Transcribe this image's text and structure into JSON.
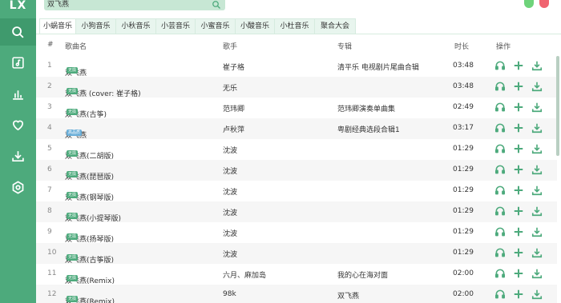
{
  "app": {
    "logo": "LX"
  },
  "search": {
    "value": "双飞燕"
  },
  "tabs": [
    {
      "label": "小蜗音乐",
      "active": true
    },
    {
      "label": "小狗音乐"
    },
    {
      "label": "小秋音乐"
    },
    {
      "label": "小芸音乐"
    },
    {
      "label": "小蜜音乐"
    },
    {
      "label": "小酸音乐"
    },
    {
      "label": "小杜音乐"
    },
    {
      "label": "聚合大会"
    }
  ],
  "table": {
    "headers": {
      "num": "#",
      "name": "歌曲名",
      "singer": "歌手",
      "album": "专辑",
      "duration": "时长",
      "ops": "操作"
    },
    "rows": [
      {
        "num": "1",
        "name": "双飞燕",
        "badge": "无损",
        "singer": "崔子格",
        "album": "清平乐 电视剧片尾曲合辑",
        "duration": "03:48"
      },
      {
        "num": "2",
        "name": "双飞燕 (cover: 崔子格)",
        "badge": "无损",
        "singer": "无乐",
        "album": "",
        "duration": "03:48"
      },
      {
        "num": "3",
        "name": "双飞燕(古筝)",
        "badge": "无损",
        "singer": "范玮卿",
        "album": "范玮卿演奏单曲集",
        "duration": "02:49"
      },
      {
        "num": "4",
        "name": "双飞燕",
        "badge": "高品质",
        "singer": "卢秋萍",
        "album": "粤剧经典选段合辑1",
        "duration": "03:17"
      },
      {
        "num": "5",
        "name": "双飞燕(二胡版)",
        "badge": "无损",
        "singer": "沈波",
        "album": "",
        "duration": "01:29"
      },
      {
        "num": "6",
        "name": "双飞燕(琵琶版)",
        "badge": "无损",
        "singer": "沈波",
        "album": "",
        "duration": "01:29"
      },
      {
        "num": "7",
        "name": "双飞燕(钢琴版)",
        "badge": "无损",
        "singer": "沈波",
        "album": "",
        "duration": "01:29"
      },
      {
        "num": "8",
        "name": "双飞燕(小提琴版)",
        "badge": "无损",
        "singer": "沈波",
        "album": "",
        "duration": "01:29"
      },
      {
        "num": "9",
        "name": "双飞燕(扬琴版)",
        "badge": "无损",
        "singer": "沈波",
        "album": "",
        "duration": "01:29"
      },
      {
        "num": "10",
        "name": "双飞燕(古筝版)",
        "badge": "无损",
        "singer": "沈波",
        "album": "",
        "duration": "01:29"
      },
      {
        "num": "11",
        "name": "双飞燕(Remix)",
        "badge": "无损",
        "singer": "六月、麻加岛",
        "album": "我的心在海对面",
        "duration": "02:00"
      },
      {
        "num": "12",
        "name": "双飞燕(Remix)",
        "badge": "无损",
        "singer": "98k",
        "album": "双飞燕",
        "duration": "02:00"
      }
    ]
  },
  "colors": {
    "accent": "#4daa7c",
    "sidebar": "#4daa7c",
    "hq_badge": "#6aaed8"
  },
  "icons": {
    "sidebar": [
      "search-icon",
      "music-list-icon",
      "chart-icon",
      "heart-icon",
      "download-icon",
      "settings-icon"
    ],
    "ops": [
      "headphones-icon",
      "add-icon",
      "download-icon"
    ]
  }
}
